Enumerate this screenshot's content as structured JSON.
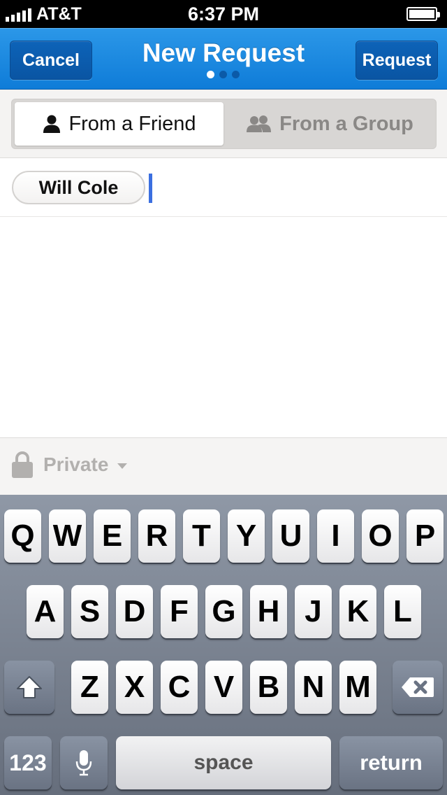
{
  "status_bar": {
    "carrier": "AT&T",
    "time": "6:37 PM"
  },
  "nav": {
    "cancel_label": "Cancel",
    "title": "New Request",
    "request_label": "Request",
    "page_dots": 3,
    "active_page": 1,
    "colors": {
      "bar": "#1a88e0",
      "button": "#0b5aa8"
    }
  },
  "segments": {
    "friend_label": "From a Friend",
    "group_label": "From a Group",
    "selected": "From a Friend",
    "friend_icon": "person-icon",
    "group_icon": "group-icon"
  },
  "recipient": {
    "chip_label": "Will Cole"
  },
  "privacy": {
    "label": "Private",
    "icon": "lock-icon"
  },
  "keyboard": {
    "row1": [
      "Q",
      "W",
      "E",
      "R",
      "T",
      "Y",
      "U",
      "I",
      "O",
      "P"
    ],
    "row2": [
      "A",
      "S",
      "D",
      "F",
      "G",
      "H",
      "J",
      "K",
      "L"
    ],
    "row3": [
      "Z",
      "X",
      "C",
      "V",
      "B",
      "N",
      "M"
    ],
    "numbers_label": "123",
    "space_label": "space",
    "return_label": "return",
    "shift_icon": "shift-icon",
    "delete_icon": "backspace-icon",
    "mic_icon": "microphone-icon"
  }
}
